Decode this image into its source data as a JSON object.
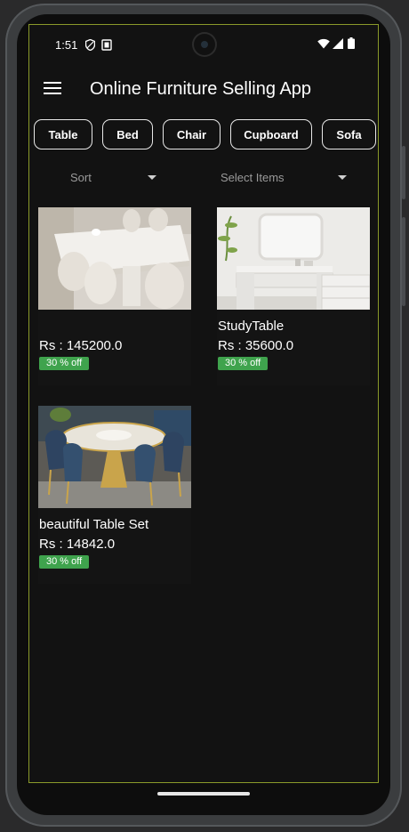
{
  "status_bar": {
    "time": "1:51",
    "icons": [
      "shield-icon",
      "sim-card-icon",
      "wifi-icon",
      "signal-icon",
      "battery-icon"
    ]
  },
  "app_bar": {
    "title": "Online Furniture Selling App",
    "menu_icon": "hamburger-menu-icon"
  },
  "categories": [
    "Table",
    "Bed",
    "Chair",
    "Cupboard",
    "Sofa"
  ],
  "filters": {
    "sort": {
      "label": "Sort"
    },
    "select": {
      "label": "Select Items"
    }
  },
  "products": [
    {
      "name": "",
      "price": "Rs : 145200.0",
      "discount": "30 % off",
      "image": "white-marble-dining-table-photo"
    },
    {
      "name": "StudyTable",
      "price": "Rs : 35600.0",
      "discount": "30 % off",
      "image": "white-study-desk-photo"
    },
    {
      "name": "beautiful Table Set",
      "price": "Rs : 14842.0",
      "discount": "30 % off",
      "image": "round-dining-table-set-photo"
    }
  ],
  "colors": {
    "screen_bg": "#121212",
    "badge_green": "#3fa34d",
    "frame_outline": "#8a9a2a"
  }
}
